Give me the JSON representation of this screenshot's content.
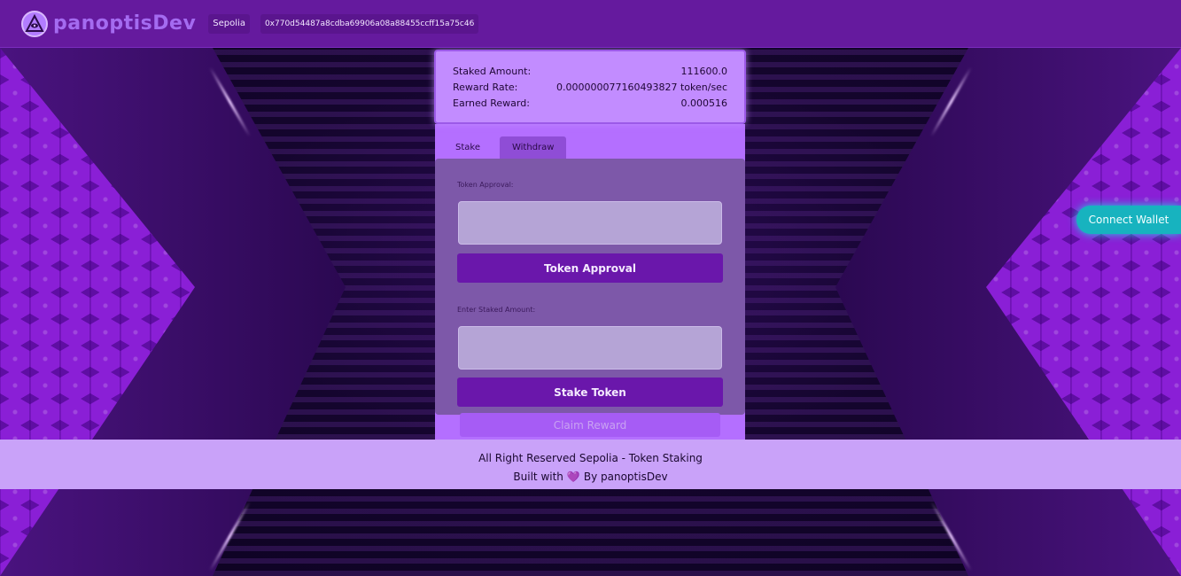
{
  "header": {
    "brand": "panoptisDev",
    "network": "Sepolia",
    "address": "0x770d54487a8cdba69906a08a88455ccff15a75c46"
  },
  "stats": {
    "staked_label": "Staked Amount:",
    "staked_value": "111600.0",
    "rate_label": "Reward Rate:",
    "rate_value": "0.000000077160493827 token/sec",
    "earned_label": "Earned Reward:",
    "earned_value": "0.000516"
  },
  "tabs": [
    "Stake",
    "Withdraw"
  ],
  "form": {
    "approval_label": "Token Approval:",
    "approval_value": "",
    "approval_button": "Token Approval",
    "stake_label": "Enter Staked Amount:",
    "stake_value": "",
    "stake_button": "Stake Token",
    "claim_button": "Claim Reward"
  },
  "connect_wallet": "Connect Wallet",
  "footer": {
    "line1": "All Right Reserved Sepolia - Token Staking",
    "built_with": "Built with",
    "heart": "💜",
    "by": "By panoptisDev"
  },
  "colors": {
    "header_bg": "#651a9e",
    "accent": "#6a17ab",
    "connect": "#17b3bf",
    "footer_bg": "#c9a2f9"
  }
}
